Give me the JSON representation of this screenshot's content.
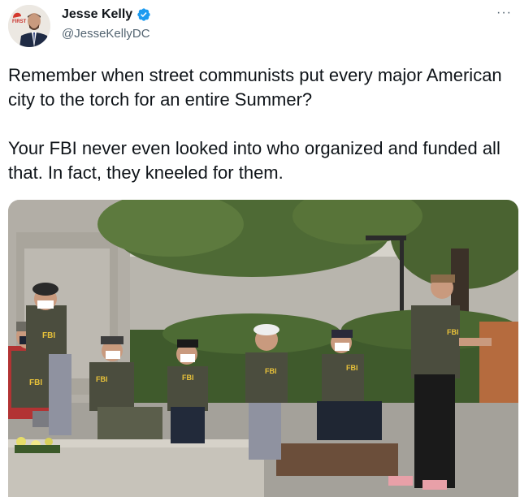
{
  "author": {
    "display_name": "Jesse Kelly",
    "handle": "@JesseKellyDC",
    "avatar_badge": "FIRST",
    "verified": true
  },
  "more_label": "···",
  "tweet": {
    "paragraphs": [
      "Remember when street communists put every major American city to the torch for an entire Summer?",
      "Your FBI never even looked into who organized and funded all that. In fact, they kneeled for them."
    ]
  },
  "media": {
    "vest_labels": [
      "FBI",
      "FBI",
      "FBI",
      "FBI",
      "FBI",
      "FBI",
      "FBI"
    ]
  },
  "colors": {
    "text": "#0f1419",
    "secondary": "#536471",
    "verified": "#1d9bf0"
  }
}
